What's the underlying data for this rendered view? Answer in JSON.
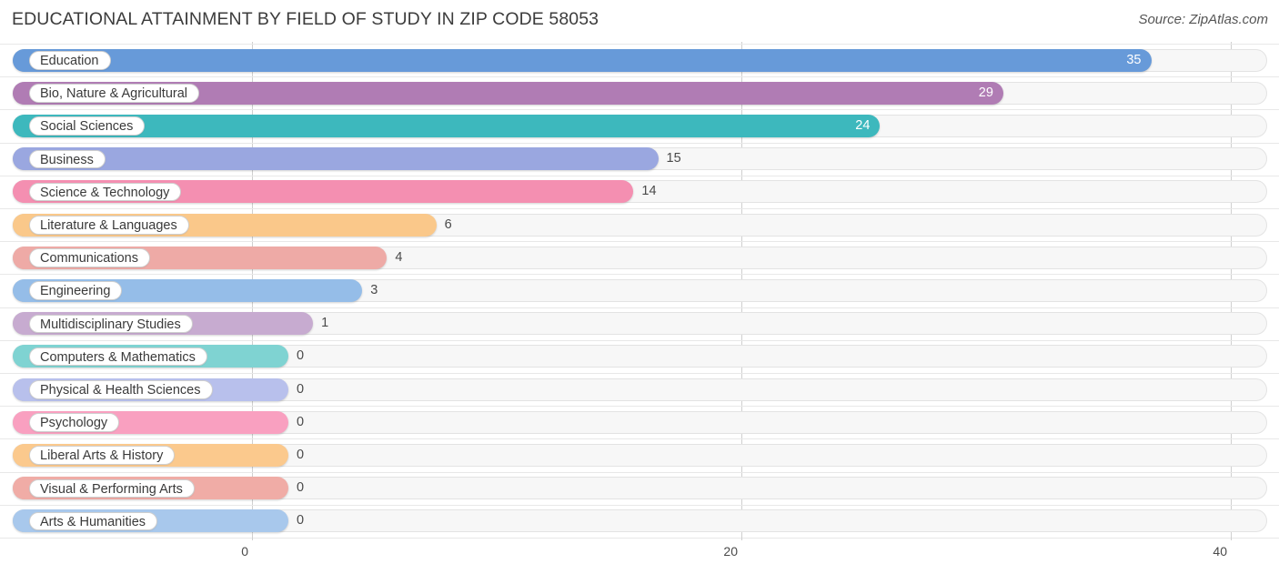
{
  "header": {
    "title": "EDUCATIONAL ATTAINMENT BY FIELD OF STUDY IN ZIP CODE 58053",
    "source": "Source: ZipAtlas.com"
  },
  "chart_data": {
    "type": "bar",
    "orientation": "horizontal",
    "title": "EDUCATIONAL ATTAINMENT BY FIELD OF STUDY IN ZIP CODE 58053",
    "xlabel": "",
    "ylabel": "",
    "xlim": [
      0,
      40
    ],
    "xticks": [
      0,
      20,
      40
    ],
    "xtick_labels": [
      "0",
      "20",
      "40"
    ],
    "grid": true,
    "legend": false,
    "categories": [
      "Education",
      "Bio, Nature & Agricultural",
      "Social Sciences",
      "Business",
      "Science & Technology",
      "Literature & Languages",
      "Communications",
      "Engineering",
      "Multidisciplinary Studies",
      "Computers & Mathematics",
      "Physical & Health Sciences",
      "Psychology",
      "Liberal Arts & History",
      "Visual & Performing Arts",
      "Arts & Humanities"
    ],
    "values": [
      35,
      29,
      24,
      15,
      14,
      6,
      4,
      3,
      1,
      0,
      0,
      0,
      0,
      0,
      0
    ],
    "value_labels": [
      "35",
      "29",
      "24",
      "15",
      "14",
      "6",
      "4",
      "3",
      "1",
      "0",
      "0",
      "0",
      "0",
      "0",
      "0"
    ],
    "colors": [
      "#679ad9",
      "#b07cb4",
      "#3db8bd",
      "#9aa7e0",
      "#f48fb1",
      "#fac88a",
      "#eeaaa6",
      "#95bde8",
      "#c7abd0",
      "#7fd3d2",
      "#b8c0ec",
      "#f9a0c0",
      "#fbc98d",
      "#f0aca6",
      "#a8c8ec"
    ]
  }
}
